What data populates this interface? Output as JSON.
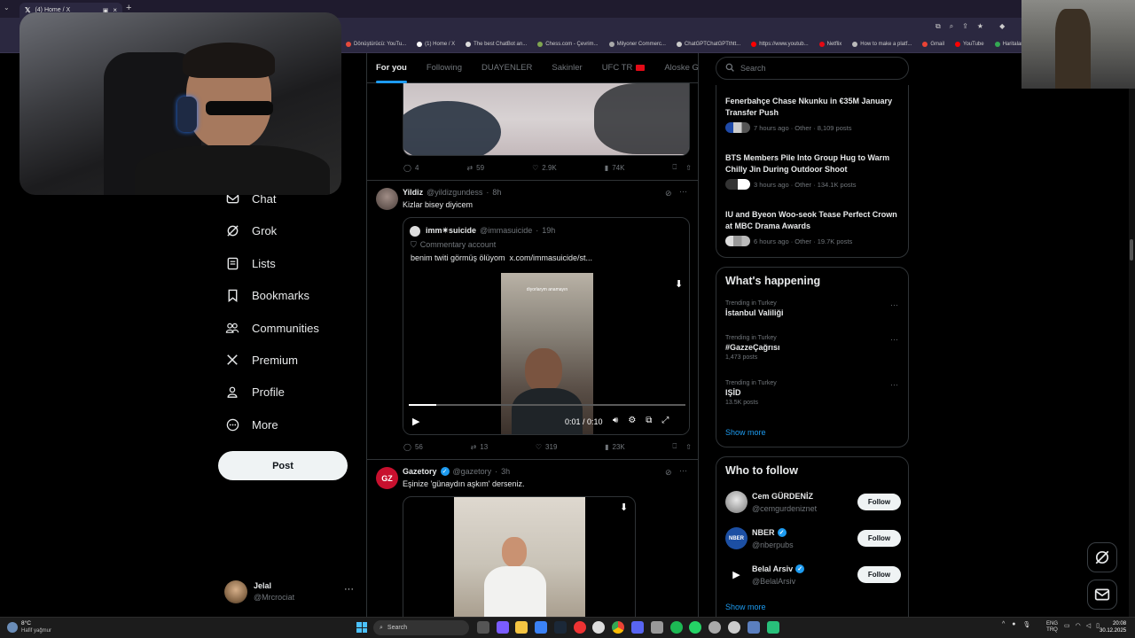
{
  "browser": {
    "tabs": [
      {
        "label": "(4) Home / X",
        "active": true
      }
    ],
    "bookmarks": [
      "Dönüştürücü: YouTu...",
      "(1) Home / X",
      "The best ChatBot an...",
      "Chess.com - Çevrim...",
      "Milyoner Commerc...",
      "ChatGPTChatGPTthtt...",
      "https://www.youtub...",
      "Netflix",
      "How to make a platf...",
      "Gmail",
      "YouTube",
      "Haritalar"
    ]
  },
  "nav": {
    "items": [
      {
        "label": "Chat",
        "icon": "chat-icon"
      },
      {
        "label": "Grok",
        "icon": "grok-icon"
      },
      {
        "label": "Lists",
        "icon": "lists-icon"
      },
      {
        "label": "Bookmarks",
        "icon": "bookmark-icon"
      },
      {
        "label": "Communities",
        "icon": "communities-icon"
      },
      {
        "label": "Premium",
        "icon": "x-logo-icon"
      },
      {
        "label": "Profile",
        "icon": "profile-icon"
      },
      {
        "label": "More",
        "icon": "more-circle-icon"
      }
    ],
    "post_label": "Post",
    "account": {
      "name": "Jelal",
      "handle": "@Mrcrociat"
    }
  },
  "feed": {
    "tabs": [
      "For you",
      "Following",
      "DUAYENLER",
      "Sakinler",
      "UFC TR",
      "Aloske Gang"
    ],
    "post1": {
      "replies": "4",
      "reposts": "59",
      "likes": "2.9K",
      "views": "74K"
    },
    "post2": {
      "name": "Yildiz",
      "handle": "@yildizgundess",
      "time": "8h",
      "text": "Kizlar bisey diyicem",
      "quote": {
        "name": "imm✴suicide",
        "handle": "@immasuicide",
        "time": "19h",
        "badge": "Commentary account",
        "text": "benim twiti görmüş ölüyom  x.com/immasuicide/st...",
        "video_caption": "diyorlarym anamayın",
        "video_time": "0:01 / 0:10",
        "progress": 0.1
      },
      "replies": "56",
      "reposts": "13",
      "likes": "319",
      "views": "23K"
    },
    "post3": {
      "name": "Gazetory",
      "handle": "@gazetory",
      "time": "3h",
      "text": "Eşinize 'günaydın aşkım' derseniz.",
      "avatar_text": "GZ"
    }
  },
  "right": {
    "search_placeholder": "Search",
    "news": [
      {
        "title": "Fenerbahçe Chase Nkunku in €35M January Transfer Push",
        "meta": "7 hours ago · Other · 8,109 posts"
      },
      {
        "title": "BTS Members Pile Into Group Hug to Warm Chilly Jin During Outdoor Shoot",
        "meta": "3 hours ago · Other · 134.1K posts"
      },
      {
        "title": "IU and Byeon Woo-seok Tease Perfect Crown at MBC Drama Awards",
        "meta": "6 hours ago · Other · 19.7K posts"
      }
    ],
    "happening": {
      "title": "What's happening",
      "trends": [
        {
          "context": "Trending in Turkey",
          "name": "İstanbul Valiliği",
          "count": ""
        },
        {
          "context": "Trending in Turkey",
          "name": "#GazzeÇağrısı",
          "count": "1,473 posts"
        },
        {
          "context": "Trending in Turkey",
          "name": "IŞİD",
          "count": "13.5K posts"
        }
      ],
      "show_more": "Show more"
    },
    "who_to_follow": {
      "title": "Who to follow",
      "accounts": [
        {
          "name": "Cem GÜRDENİZ",
          "handle": "@cemgurdeniznet",
          "verified": false
        },
        {
          "name": "NBER",
          "handle": "@nberpubs",
          "verified": true
        },
        {
          "name": "Belal Arsiv",
          "handle": "@BelalArsiv",
          "verified": true
        }
      ],
      "follow_label": "Follow",
      "nber_logo": "NBER",
      "show_more": "Show more"
    }
  },
  "taskbar": {
    "weather_temp": "8°C",
    "weather_desc": "Hafif yağmur",
    "search_label": "Search",
    "lang_top": "ENG",
    "lang_bottom": "TRQ",
    "time": "20:08",
    "date": "30.12.2025"
  },
  "colors": {
    "accent": "#1d9bf0",
    "background": "#000000",
    "border": "#2f3336",
    "muted": "#71767b"
  }
}
